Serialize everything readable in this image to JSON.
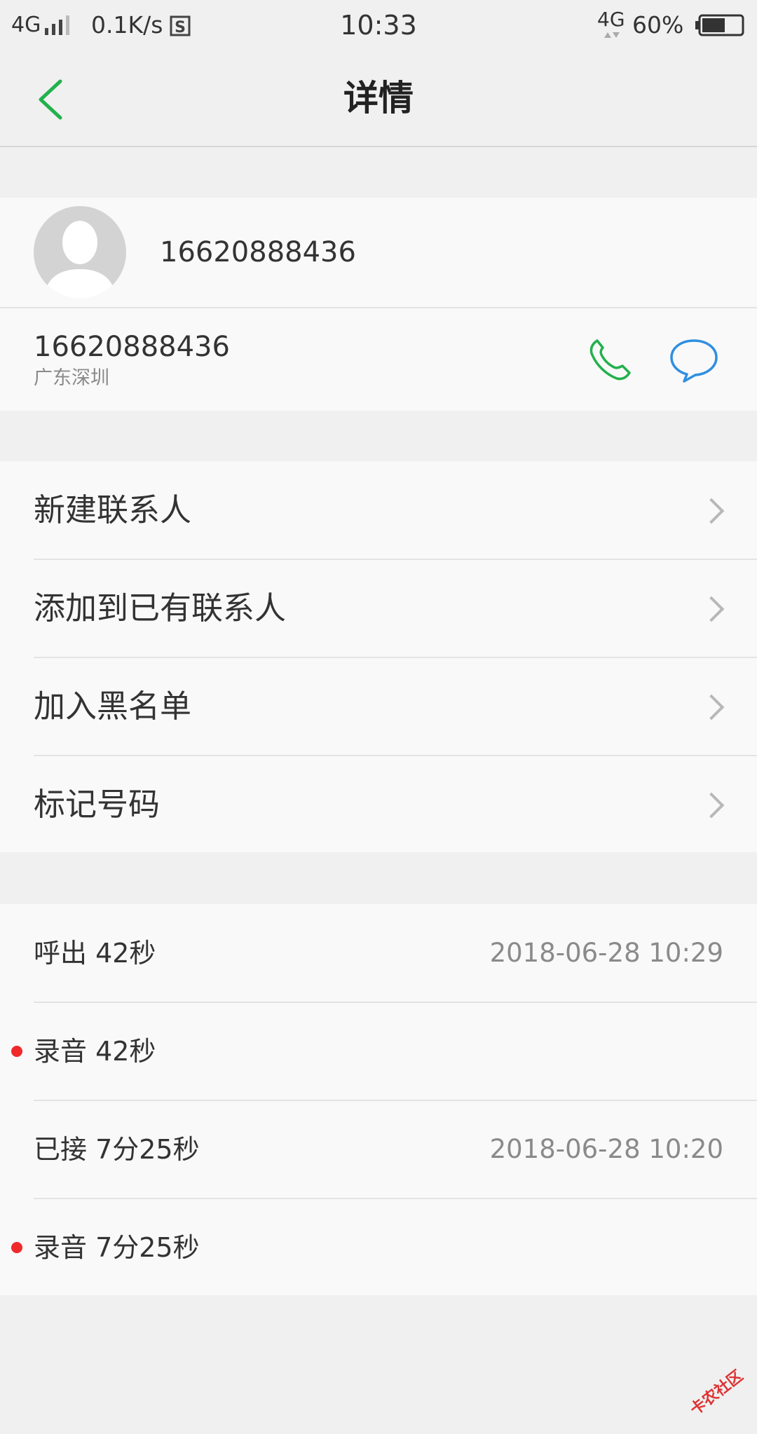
{
  "status_bar": {
    "network": "4G",
    "speed": "0.1K/s",
    "time": "10:33",
    "network_right": "4G",
    "battery": "60%",
    "battery_level": 0.6
  },
  "header": {
    "title": "详情"
  },
  "contact": {
    "name": "16620888436",
    "number": "16620888436",
    "location": "广东深圳"
  },
  "menu": {
    "items": [
      {
        "label": "新建联系人"
      },
      {
        "label": "添加到已有联系人"
      },
      {
        "label": "加入黑名单"
      },
      {
        "label": "标记号码"
      }
    ]
  },
  "call_log": {
    "entries": [
      {
        "label": "呼出 42秒",
        "time": "2018-06-28 10:29"
      },
      {
        "label": "录音 42秒",
        "time": ""
      },
      {
        "label": "已接 7分25秒",
        "time": "2018-06-28 10:20"
      },
      {
        "label": "录音 7分25秒",
        "time": ""
      }
    ]
  },
  "watermark": {
    "text": "卡农社区"
  },
  "colors": {
    "accent_green": "#22b14c",
    "message_blue": "#2f8fe0",
    "record_red": "#f02a2a"
  }
}
